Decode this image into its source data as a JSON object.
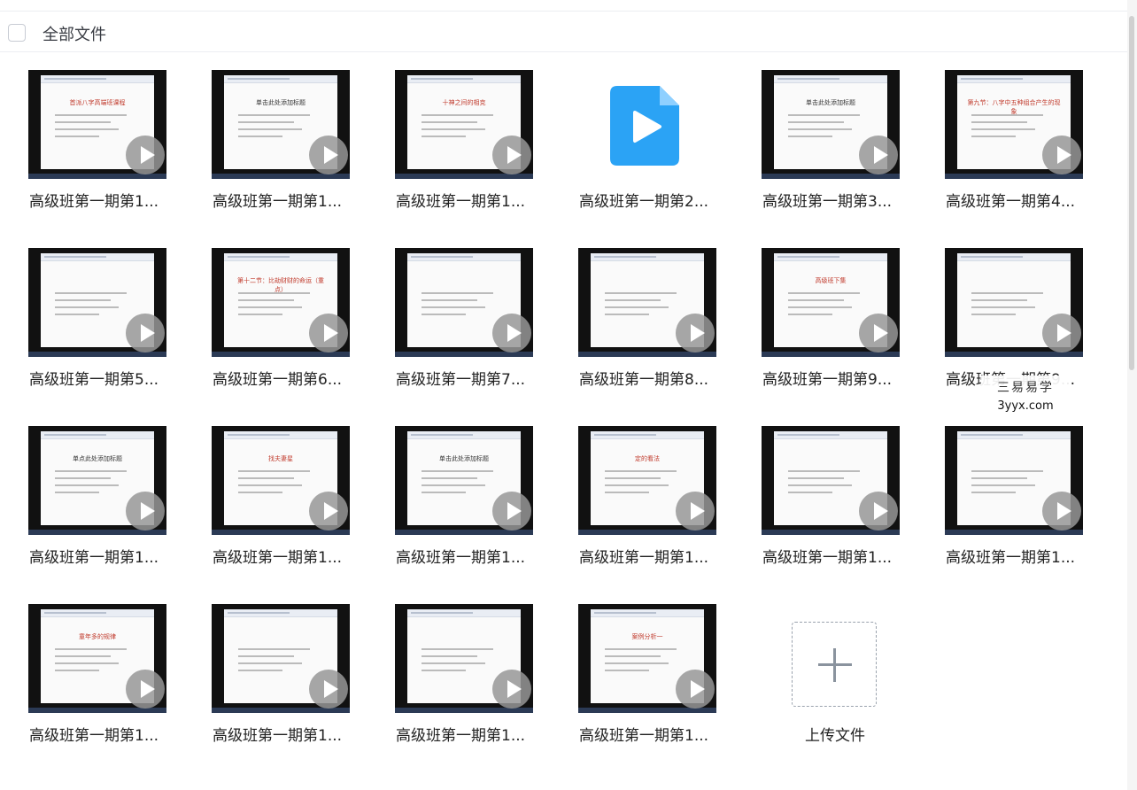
{
  "header": {
    "title": "全部文件"
  },
  "files": [
    {
      "name": "高级班第一期第1...",
      "slide_title": "首派八字高端班课程",
      "accent": "#c0392b",
      "type": "video"
    },
    {
      "name": "高级班第一期第1...",
      "slide_title": "单击此处添加标题",
      "accent": "#333333",
      "type": "video"
    },
    {
      "name": "高级班第一期第1...",
      "slide_title": "十神之间的相克",
      "accent": "#c0392b",
      "type": "video"
    },
    {
      "name": "高级班第一期第2...",
      "slide_title": "",
      "accent": "#2ba3f5",
      "type": "video-icon"
    },
    {
      "name": "高级班第一期第3...",
      "slide_title": "单击此处添加标题",
      "accent": "#333333",
      "type": "video"
    },
    {
      "name": "高级班第一期第4...",
      "slide_title": "第九节：八字中五种组合产生的现象",
      "accent": "#c0392b",
      "type": "video"
    },
    {
      "name": "高级班第一期第5...",
      "slide_title": "",
      "accent": "#333333",
      "type": "video"
    },
    {
      "name": "高级班第一期第6...",
      "slide_title": "第十二节：比劫财财的命运（重点）",
      "accent": "#c0392b",
      "type": "video"
    },
    {
      "name": "高级班第一期第7...",
      "slide_title": "",
      "accent": "#333333",
      "type": "video"
    },
    {
      "name": "高级班第一期第8...",
      "slide_title": "",
      "accent": "#333333",
      "type": "video"
    },
    {
      "name": "高级班第一期第9...",
      "slide_title": "高级班下集",
      "accent": "#c0392b",
      "type": "video"
    },
    {
      "name": "高级班第一期第9...",
      "slide_title": "",
      "accent": "#333333",
      "type": "video"
    },
    {
      "name": "高级班第一期第1...",
      "slide_title": "单点此处添加标题",
      "accent": "#333333",
      "type": "video"
    },
    {
      "name": "高级班第一期第1...",
      "slide_title": "找夫妻星",
      "accent": "#c0392b",
      "type": "video"
    },
    {
      "name": "高级班第一期第1...",
      "slide_title": "单击此处添加标题",
      "accent": "#333333",
      "type": "video"
    },
    {
      "name": "高级班第一期第1...",
      "slide_title": "定的看法",
      "accent": "#c0392b",
      "type": "video"
    },
    {
      "name": "高级班第一期第1...",
      "slide_title": "",
      "accent": "#333333",
      "type": "video"
    },
    {
      "name": "高级班第一期第1...",
      "slide_title": "",
      "accent": "#333333",
      "type": "video"
    },
    {
      "name": "高级班第一期第1...",
      "slide_title": "童年多的规律",
      "accent": "#c0392b",
      "type": "video"
    },
    {
      "name": "高级班第一期第1...",
      "slide_title": "",
      "accent": "#c0392b",
      "type": "video"
    },
    {
      "name": "高级班第一期第1...",
      "slide_title": "",
      "accent": "#c0392b",
      "type": "video"
    },
    {
      "name": "高级班第一期第1...",
      "slide_title": "案例分析一",
      "accent": "#c0392b",
      "type": "video"
    }
  ],
  "upload": {
    "label": "上传文件"
  },
  "watermark": {
    "cn": "三易易学",
    "en": "3yyx.com"
  }
}
